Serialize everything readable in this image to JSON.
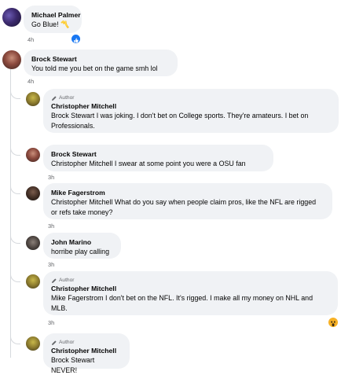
{
  "comments": [
    {
      "name": "Michael Palmer",
      "text": "Go Blue! 〽️",
      "time": "4h"
    },
    {
      "name": "Brock Stewart",
      "text": "You told me you bet on the game smh lol",
      "time": "4h"
    }
  ],
  "replies": [
    {
      "badge": "Author",
      "name": "Christopher Mitchell",
      "text": "Brock Stewart I was joking. I don't bet on College sports. They're amateurs. I bet on Professionals."
    },
    {
      "name": "Brock Stewart",
      "text": "Christopher Mitchell I swear at some point you were a OSU fan",
      "time": "3h"
    },
    {
      "name": "Mike Fagerstrom",
      "text": "Christopher Mitchell What do you say when people claim pros, like the NFL are rigged or refs take money?",
      "time": "3h"
    },
    {
      "name": "John Marino",
      "text": "horribe play calling",
      "time": "3h"
    },
    {
      "badge": "Author",
      "name": "Christopher Mitchell",
      "text": "Mike Fagerstrom I don't bet on the NFL. It's rigged. I make all my money on NHL and MLB.",
      "time": "3h"
    },
    {
      "badge": "Author",
      "name": "Christopher Mitchell",
      "text": "Brock Stewart NEVER!"
    }
  ],
  "colors": {
    "like": "#1877f2",
    "wow": "#f7b125",
    "bubble": "#f0f2f5",
    "meta": "#65676b"
  }
}
